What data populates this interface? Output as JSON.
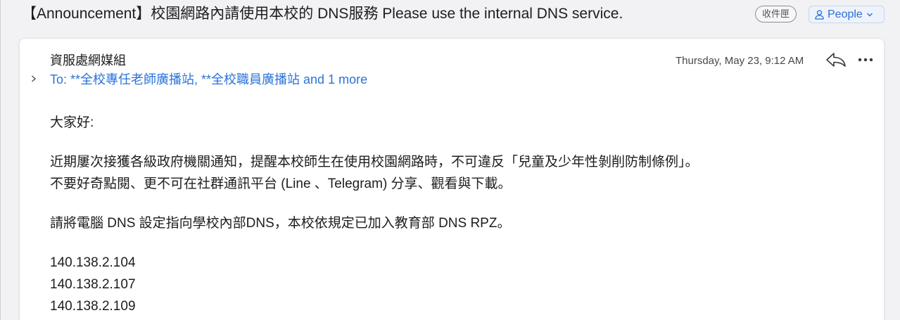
{
  "subject": "【Announcement】校園網路內請使用本校的 DNS服務 Please use the internal DNS service.",
  "folder_badge": "收件匣",
  "people_button": {
    "label": "People",
    "icon": "person-icon",
    "chevron_icon": "chevron-down-icon"
  },
  "message": {
    "sender": "資服處網媒組",
    "recipients": "To: **全校專任老師廣播站, **全校職員廣播站 and 1 more",
    "date": "Thursday, May 23, 9:12 AM",
    "icons": [
      "chevron-right-icon",
      "reply-icon",
      "more-icon"
    ],
    "body": {
      "greeting": "大家好:",
      "p1_line1": "近期屢次接獲各級政府機關通知，提醒本校師生在使用校園網路時，不可違反「兒童及少年性剝削防制條例」。",
      "p1_line2": "不要好奇點閱、更不可在社群通訊平台 (Line 、Telegram) 分享、觀看與下載。",
      "p2": "請將電腦 DNS 設定指向學校內部DNS，本校依規定已加入教育部 DNS RPZ。",
      "dns_servers": [
        "140.138.2.104",
        "140.138.2.107",
        "140.138.2.109"
      ]
    }
  },
  "colors": {
    "link": "#2b73d8",
    "people_accent": "#2b6fd6",
    "background": "#f2f2f4",
    "card": "#ffffff"
  }
}
